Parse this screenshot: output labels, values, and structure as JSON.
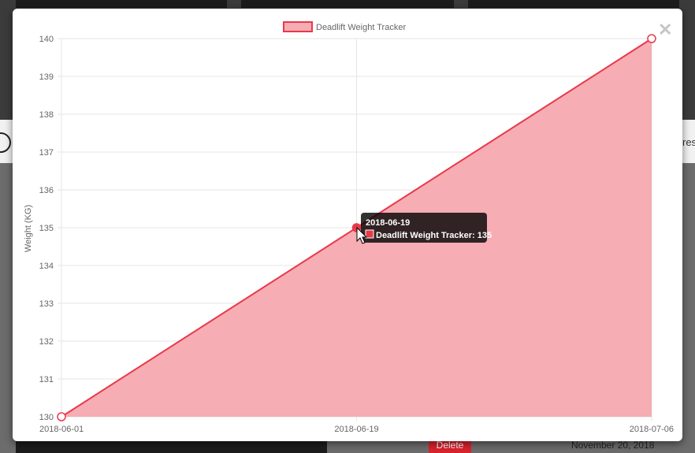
{
  "background": {
    "delete_label": "Delete",
    "date_text": "November 20, 2018",
    "partial_text": "res"
  },
  "modal": {
    "close_label": "✕"
  },
  "colors": {
    "line": "#e8394a",
    "fill": "#f6adb3",
    "grid": "#e6e6e6",
    "tooltip_bg": "#000000"
  },
  "chart_data": {
    "type": "line",
    "x": [
      "2018-06-01",
      "2018-06-19",
      "2018-07-06"
    ],
    "series": [
      {
        "name": "Deadlift Weight Tracker",
        "values": [
          130,
          135,
          140
        ]
      }
    ],
    "xlabel": "",
    "ylabel": "Weight (KG)",
    "ylim": [
      130,
      140
    ],
    "yticks": [
      "130",
      "131",
      "132",
      "133",
      "134",
      "135",
      "136",
      "137",
      "138",
      "139",
      "140"
    ],
    "grid": true,
    "filled": true,
    "legend_position": "top",
    "tooltip": {
      "title": "2018-06-19",
      "label": "Deadlift Weight Tracker: 135",
      "point_index": 1
    }
  }
}
